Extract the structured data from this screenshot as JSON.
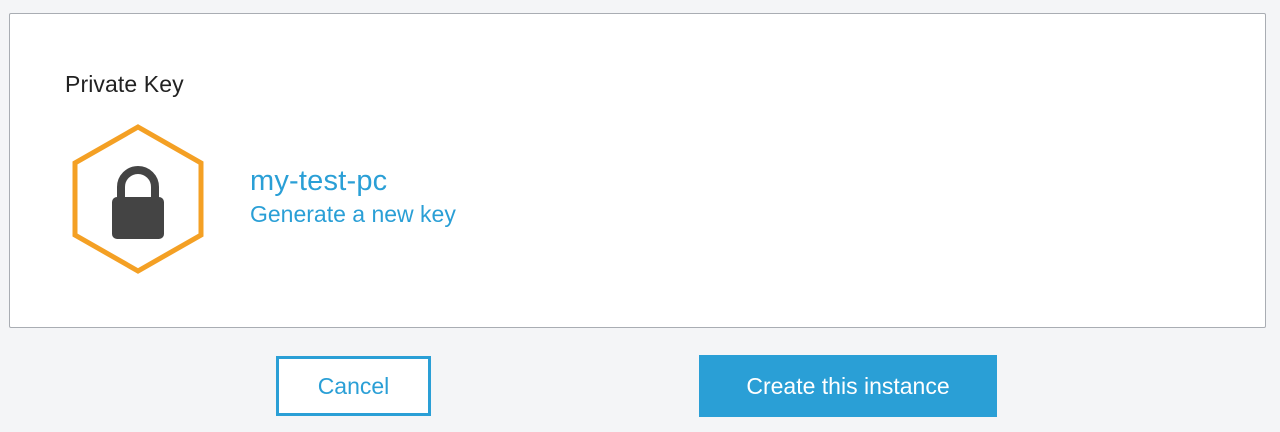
{
  "private_key": {
    "title": "Private Key",
    "icon": "lock-hexagon-icon",
    "key_name": "my-test-pc",
    "generate_link": "Generate a new key"
  },
  "actions": {
    "cancel_label": "Cancel",
    "create_label": "Create this instance"
  },
  "colors": {
    "accent": "#2a9fd6",
    "hexagon": "#f4a024",
    "lock": "#444444",
    "panel_border": "#a9adb3"
  }
}
